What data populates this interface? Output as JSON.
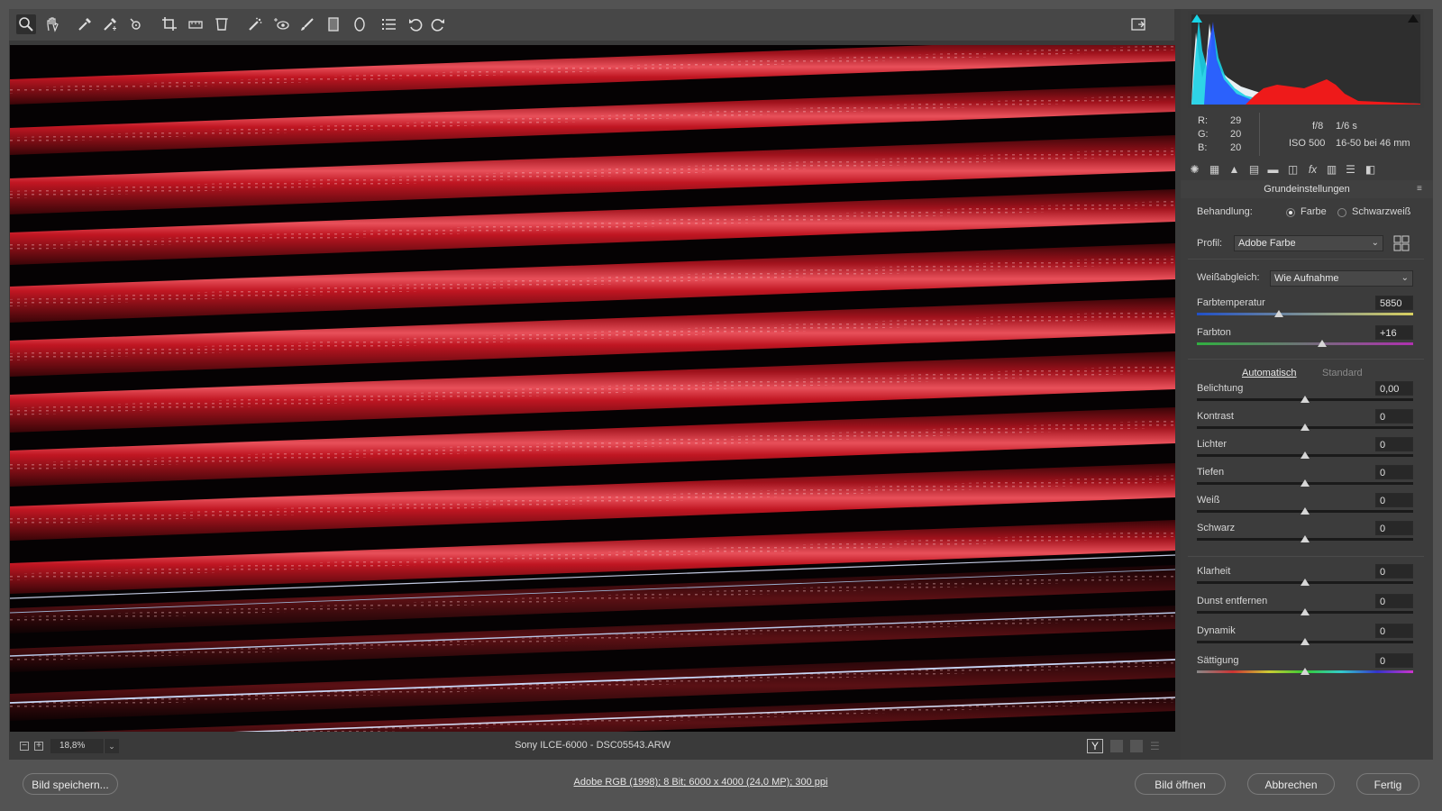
{
  "toolbar": {
    "tools": [
      "zoom-icon",
      "hand-icon",
      "white-balance-icon",
      "color-sampler-icon",
      "target-adjust-icon",
      "crop-icon",
      "straighten-icon",
      "transform-icon",
      "spot-removal-icon",
      "red-eye-icon",
      "adjustment-brush-icon",
      "graduated-filter-icon",
      "radial-filter-icon",
      "preferences-icon",
      "rotate-ccw-icon",
      "rotate-cw-icon"
    ]
  },
  "info": {
    "r_label": "R:",
    "r_value": "29",
    "g_label": "G:",
    "g_value": "20",
    "b_label": "B:",
    "b_value": "20",
    "aperture": "f/8",
    "shutter": "1/6 s",
    "iso": "ISO 500",
    "lens": "16-50 bei 46 mm"
  },
  "panel": {
    "title": "Grundeinstellungen",
    "treatment_label": "Behandlung:",
    "treatment_color": "Farbe",
    "treatment_bw": "Schwarzweiß",
    "profile_label": "Profil:",
    "profile_value": "Adobe Farbe",
    "wb_label": "Weißabgleich:",
    "wb_value": "Wie Aufnahme",
    "auto_link": "Automatisch",
    "default_link": "Standard"
  },
  "sliders": [
    {
      "label": "Farbtemperatur",
      "value": "5850",
      "level": 0.38
    },
    {
      "label": "Farbton",
      "value": "+16",
      "level": 0.58
    },
    {
      "label": "Belichtung",
      "value": "0,00",
      "level": 0.5
    },
    {
      "label": "Kontrast",
      "value": "0",
      "level": 0.5
    },
    {
      "label": "Lichter",
      "value": "0",
      "level": 0.5
    },
    {
      "label": "Tiefen",
      "value": "0",
      "level": 0.5
    },
    {
      "label": "Weiß",
      "value": "0",
      "level": 0.5
    },
    {
      "label": "Schwarz",
      "value": "0",
      "level": 0.5
    },
    {
      "label": "Klarheit",
      "value": "0",
      "level": 0.5
    },
    {
      "label": "Dunst entfernen",
      "value": "0",
      "level": 0.5
    },
    {
      "label": "Dynamik",
      "value": "0",
      "level": 0.5
    },
    {
      "label": "Sättigung",
      "value": "0",
      "level": 0.5
    }
  ],
  "statusbar": {
    "zoom": "18,8%",
    "filename": "Sony ILCE-6000 - DSC05543.ARW",
    "y_label": "Y"
  },
  "footer": {
    "save_label": "Bild speichern...",
    "workflow_link": "Adobe RGB (1998); 8 Bit; 6000 x 4000 (24,0 MP); 300 ppi",
    "open_label": "Bild öffnen",
    "cancel_label": "Abbrechen",
    "done_label": "Fertig"
  },
  "colors": {
    "accent_red": "#c8141e",
    "histogram_cyan": "#18d6e8",
    "histogram_blue": "#2050ff"
  }
}
